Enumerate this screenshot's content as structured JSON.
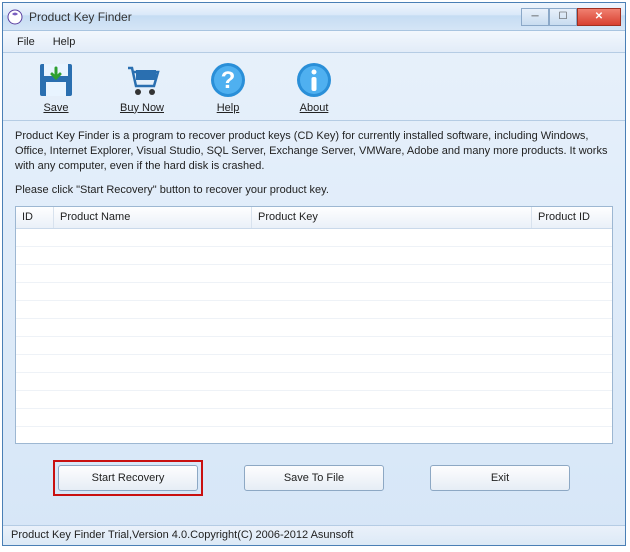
{
  "window": {
    "title": "Product Key Finder"
  },
  "menu": {
    "file": "File",
    "help": "Help"
  },
  "toolbar": {
    "save": "Save",
    "buynow": "Buy Now",
    "help": "Help",
    "about": "About"
  },
  "content": {
    "description": "Product Key Finder is a program to recover product keys (CD Key) for currently installed software, including Windows, Office, Internet Explorer, Visual Studio, SQL Server, Exchange Server, VMWare, Adobe and many more products. It works with any computer, even if the hard disk is crashed.",
    "instruction": "Please click \"Start Recovery\" button to recover your product key."
  },
  "table": {
    "headers": {
      "id": "ID",
      "product_name": "Product Name",
      "product_key": "Product Key",
      "product_id": "Product ID"
    },
    "rows": []
  },
  "buttons": {
    "start_recovery": "Start Recovery",
    "save_to_file": "Save To File",
    "exit": "Exit"
  },
  "status": "Product Key Finder Trial,Version 4.0.Copyright(C) 2006-2012 Asunsoft"
}
